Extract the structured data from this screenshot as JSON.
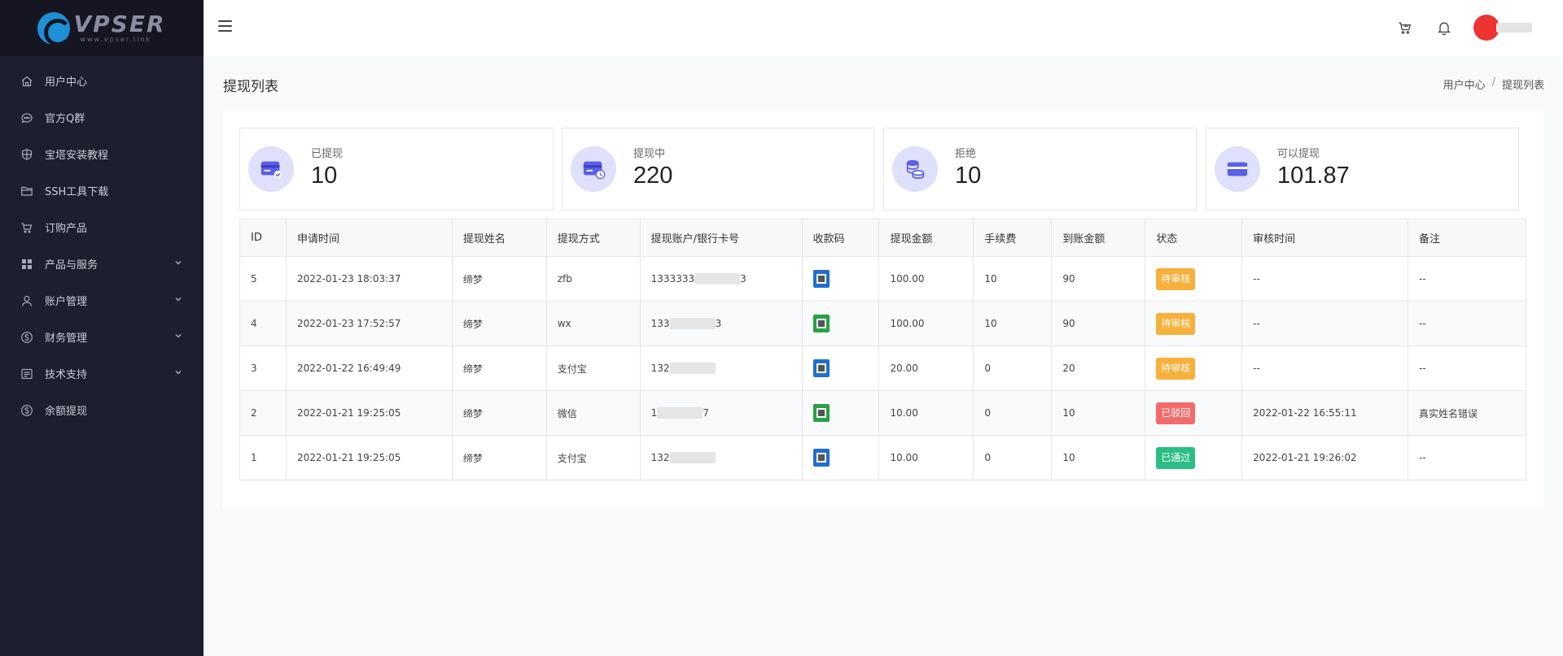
{
  "brand": {
    "logo_text": "VPSER",
    "logo_sub": "www.vpser.link"
  },
  "sidebar": {
    "items": [
      {
        "label": "用户中心",
        "icon": "home-icon",
        "has_children": false
      },
      {
        "label": "官方Q群",
        "icon": "chat-icon",
        "has_children": false
      },
      {
        "label": "宝塔安装教程",
        "icon": "shield-icon",
        "has_children": false
      },
      {
        "label": "SSH工具下载",
        "icon": "folder-icon",
        "has_children": false
      },
      {
        "label": "订购产品",
        "icon": "cart-icon",
        "has_children": false
      },
      {
        "label": "产品与服务",
        "icon": "grid-icon",
        "has_children": true
      },
      {
        "label": "账户管理",
        "icon": "user-icon",
        "has_children": true
      },
      {
        "label": "财务管理",
        "icon": "dollar-icon",
        "has_children": true
      },
      {
        "label": "技术支持",
        "icon": "list-icon",
        "has_children": true
      },
      {
        "label": "余额提现",
        "icon": "dollar-icon",
        "has_children": false
      }
    ]
  },
  "header": {
    "icons": [
      "menu-icon",
      "cart-icon",
      "bell-icon",
      "avatar"
    ]
  },
  "page": {
    "title": "提现列表",
    "breadcrumb": {
      "home": "用户中心",
      "sep": "/",
      "current": "提现列表"
    }
  },
  "stats": [
    {
      "label": "已提现",
      "value": "10",
      "icon": "card-check-icon"
    },
    {
      "label": "提现中",
      "value": "220",
      "icon": "card-clock-icon"
    },
    {
      "label": "拒绝",
      "value": "10",
      "icon": "coins-icon"
    },
    {
      "label": "可以提现",
      "value": "101.87",
      "icon": "card-icon"
    }
  ],
  "colors": {
    "sidebar_bg": "#1e1f2e",
    "accent": "#5b5fe6",
    "warn": "#f7b03a",
    "danger": "#f16b6c",
    "success": "#2bbf86"
  },
  "table": {
    "headers": [
      "ID",
      "申请时间",
      "提现姓名",
      "提现方式",
      "提现账户/银行卡号",
      "收款码",
      "提现金额",
      "手续费",
      "到账金额",
      "状态",
      "审核时间",
      "备注"
    ],
    "rows": [
      {
        "id": "5",
        "time": "2022-01-23 18:03:37",
        "name": "缔梦",
        "method": "zfb",
        "account": "1333333",
        "account_tail": "3",
        "qr": "blue",
        "amount": "100.00",
        "fee": "10",
        "net": "90",
        "status": "待审核",
        "status_type": "warn",
        "review_time": "--",
        "note": "--"
      },
      {
        "id": "4",
        "time": "2022-01-23 17:52:57",
        "name": "缔梦",
        "method": "wx",
        "account": "133",
        "account_tail": "3",
        "qr": "green",
        "amount": "100.00",
        "fee": "10",
        "net": "90",
        "status": "待审核",
        "status_type": "warn",
        "review_time": "--",
        "note": "--"
      },
      {
        "id": "3",
        "time": "2022-01-22 16:49:49",
        "name": "缔梦",
        "method": "支付宝",
        "account": "132",
        "account_tail": "",
        "qr": "blue",
        "amount": "20.00",
        "fee": "0",
        "net": "20",
        "status": "待审核",
        "status_type": "warn",
        "review_time": "--",
        "note": "--"
      },
      {
        "id": "2",
        "time": "2022-01-21 19:25:05",
        "name": "缔梦",
        "method": "微信",
        "account": "1",
        "account_tail": "7",
        "qr": "green",
        "amount": "10.00",
        "fee": "0",
        "net": "10",
        "status": "已驳回",
        "status_type": "danger",
        "review_time": "2022-01-22 16:55:11",
        "note": "真实姓名错误"
      },
      {
        "id": "1",
        "time": "2022-01-21 19:25:05",
        "name": "缔梦",
        "method": "支付宝",
        "account": "132",
        "account_tail": "",
        "qr": "blue",
        "amount": "10.00",
        "fee": "0",
        "net": "10",
        "status": "已通过",
        "status_type": "success",
        "review_time": "2022-01-21 19:26:02",
        "note": "--"
      }
    ]
  }
}
